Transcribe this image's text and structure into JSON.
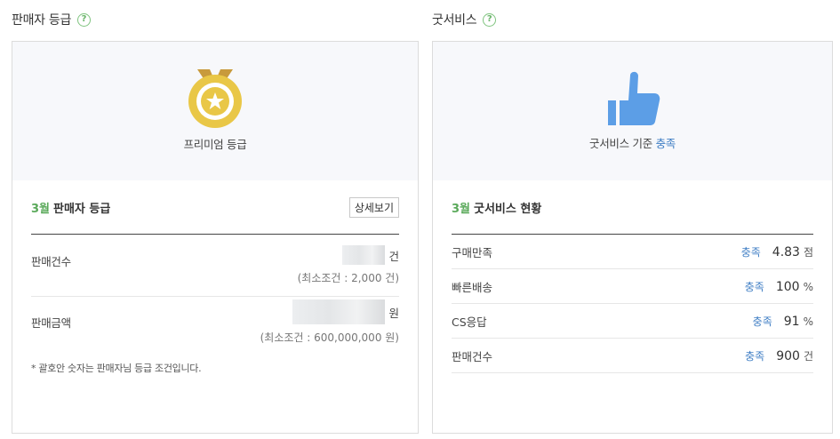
{
  "seller_grade": {
    "section_title": "판매자 등급",
    "help_icon": "?",
    "grade_caption": "프리미엄 등급",
    "month": "3월",
    "detail_heading": "판매자 등급",
    "detail_button": "상세보기",
    "stats": [
      {
        "label": "판매건수",
        "unit": "건",
        "condition": "(최소조건 : 2,000 건)"
      },
      {
        "label": "판매금액",
        "unit": "원",
        "condition": "(최소조건 : 600,000,000 원)"
      }
    ],
    "note": "* 괄호안 숫자는 판매자님 등급 조건입니다.",
    "medal_colors": {
      "ribbon": "#c89a3c",
      "ring": "#e9c747",
      "inner": "#ffffff",
      "star": "#e9c747"
    }
  },
  "good_service": {
    "section_title": "굿서비스",
    "help_icon": "?",
    "caption_prefix": "굿서비스 기준",
    "caption_status": "충족",
    "month": "3월",
    "detail_heading": "굿서비스 현황",
    "rows": [
      {
        "label": "구매만족",
        "status": "충족",
        "value": "4.83",
        "unit": "점"
      },
      {
        "label": "빠른배송",
        "status": "충족",
        "value": "100",
        "unit": "%"
      },
      {
        "label": "CS응답",
        "status": "충족",
        "value": "91",
        "unit": "%"
      },
      {
        "label": "판매건수",
        "status": "충족",
        "value": "900",
        "unit": "건"
      }
    ],
    "thumb_color": "#5c9ee6",
    "status_color": "#3f7ec4"
  }
}
